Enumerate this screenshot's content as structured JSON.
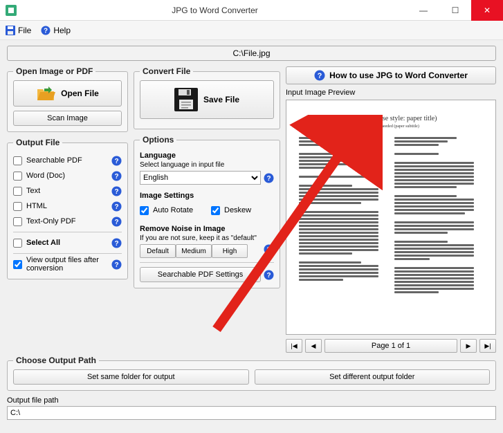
{
  "window": {
    "title": "JPG to Word Converter"
  },
  "menu": {
    "file": "File",
    "help": "Help"
  },
  "filepath": "C:\\File.jpg",
  "open_section": {
    "legend": "Open Image or PDF",
    "open_btn": "Open File",
    "scan_btn": "Scan Image"
  },
  "convert_section": {
    "legend": "Convert File",
    "save_btn": "Save File"
  },
  "output_section": {
    "legend": "Output File",
    "items": [
      "Searchable PDF",
      "Word (Doc)",
      "Text",
      "HTML",
      "Text-Only PDF"
    ],
    "select_all": "Select All",
    "view_after": "View output files after conversion"
  },
  "options_section": {
    "legend": "Options",
    "language_label": "Language",
    "language_hint": "Select language in input file",
    "language_value": "English",
    "image_settings_label": "Image Settings",
    "auto_rotate": "Auto Rotate",
    "deskew": "Deskew",
    "noise_label": "Remove Noise in Image",
    "noise_hint": "If you are not sure, keep it as \"default\"",
    "noise_buttons": [
      "Default",
      "Medium",
      "High"
    ],
    "pdf_settings_btn": "Searchable PDF Settings"
  },
  "howto_btn": "How to use JPG to Word Converter",
  "preview": {
    "label": "Input Image Preview",
    "doc_title": "Paper Title (use style: paper title)",
    "doc_subtitle": "Subtitle as needed (paper subtitle)"
  },
  "pager": {
    "status": "Page 1 of 1"
  },
  "choose_path": {
    "legend": "Choose Output Path",
    "same_btn": "Set same folder for output",
    "diff_btn": "Set different output folder"
  },
  "outpath": {
    "label": "Output file path",
    "value": "C:\\"
  }
}
